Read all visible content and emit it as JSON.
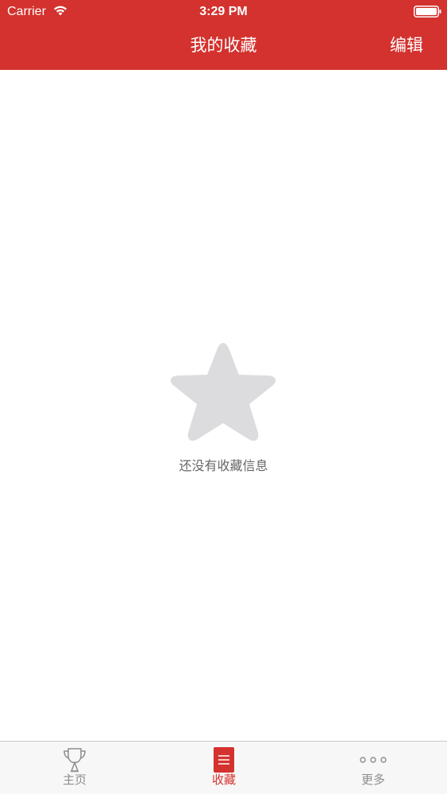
{
  "status_bar": {
    "carrier": "Carrier",
    "time": "3:29 PM",
    "wifi_icon": "wifi-icon",
    "battery_icon": "battery-icon"
  },
  "nav": {
    "title": "我的收藏",
    "edit_label": "编辑"
  },
  "empty_state": {
    "icon": "star-icon",
    "message": "还没有收藏信息"
  },
  "tabbar": {
    "tabs": [
      {
        "label": "主页",
        "icon": "trophy-icon",
        "selected": false
      },
      {
        "label": "收藏",
        "icon": "favorites-list-icon",
        "selected": true
      },
      {
        "label": "更多",
        "icon": "more-dots-icon",
        "selected": false
      }
    ]
  },
  "colors": {
    "accent": "#d3322e",
    "empty_icon": "#dcdcde",
    "tab_inactive": "#8e8e8e",
    "tabbar_bg": "#f7f7f7"
  }
}
